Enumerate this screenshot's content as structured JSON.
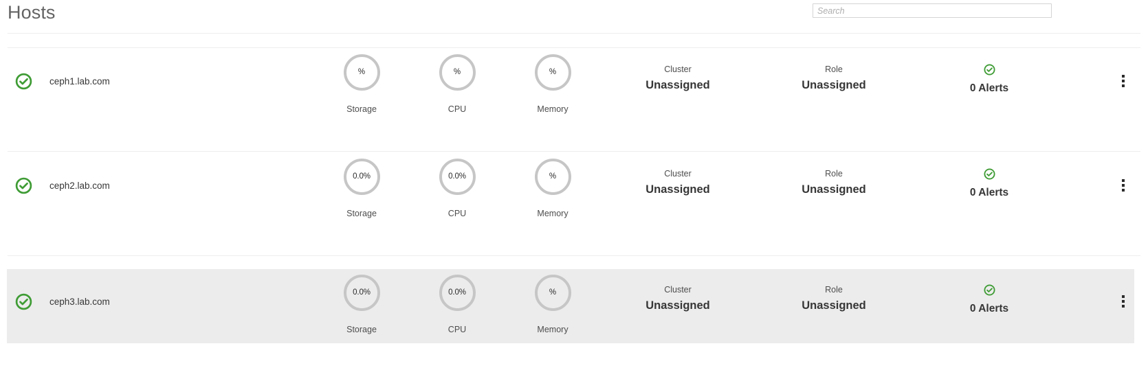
{
  "header": {
    "title": "Hosts",
    "search": {
      "placeholder": "Search",
      "value": ""
    }
  },
  "columns": {
    "gauge_labels": [
      "Storage",
      "CPU",
      "Memory"
    ],
    "cluster_label": "Cluster",
    "role_label": "Role"
  },
  "colors": {
    "status_green": "#3f9c35",
    "gauge_ring": "#c6c6c6",
    "divider": "#ededed",
    "selected_row": "#ececec",
    "title_text": "#646464",
    "body_text": "#363636"
  },
  "rows": [
    {
      "status_icon": "circle-check-icon",
      "hostname": "ceph1.lab.com",
      "gauges": [
        {
          "label": "Storage",
          "value": "%"
        },
        {
          "label": "CPU",
          "value": "%"
        },
        {
          "label": "Memory",
          "value": "%"
        }
      ],
      "cluster_label": "Cluster",
      "cluster_value": "Unassigned",
      "role_label": "Role",
      "role_value": "Unassigned",
      "alerts_icon": "circle-check-icon",
      "alerts_text": "0 Alerts",
      "selected": false
    },
    {
      "status_icon": "circle-check-icon",
      "hostname": "ceph2.lab.com",
      "gauges": [
        {
          "label": "Storage",
          "value": "0.0%"
        },
        {
          "label": "CPU",
          "value": "0.0%"
        },
        {
          "label": "Memory",
          "value": "%"
        }
      ],
      "cluster_label": "Cluster",
      "cluster_value": "Unassigned",
      "role_label": "Role",
      "role_value": "Unassigned",
      "alerts_icon": "circle-check-icon",
      "alerts_text": "0 Alerts",
      "selected": false
    },
    {
      "status_icon": "circle-check-icon",
      "hostname": "ceph3.lab.com",
      "gauges": [
        {
          "label": "Storage",
          "value": "0.0%"
        },
        {
          "label": "CPU",
          "value": "0.0%"
        },
        {
          "label": "Memory",
          "value": "%"
        }
      ],
      "cluster_label": "Cluster",
      "cluster_value": "Unassigned",
      "role_label": "Role",
      "role_value": "Unassigned",
      "alerts_icon": "circle-check-icon",
      "alerts_text": "0 Alerts",
      "selected": true
    }
  ]
}
